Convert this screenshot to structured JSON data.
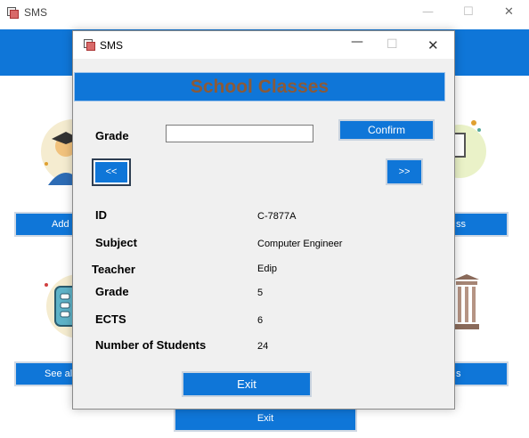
{
  "background_window": {
    "title": "SMS",
    "controls": {
      "minimize": "—",
      "maximize": "☐",
      "close": "✕"
    },
    "buttons": {
      "add_left": "Add S",
      "manage_right": "ss",
      "see_all_left": "See all",
      "see_all_right": "s",
      "exit": "Exit"
    }
  },
  "dialog": {
    "title": "SMS",
    "controls": {
      "minimize": "—",
      "maximize": "☐",
      "close": "✕"
    },
    "header": "School Classes",
    "grade_label": "Grade",
    "grade_input": {
      "value": "",
      "placeholder": ""
    },
    "confirm_label": "Confirm",
    "prev_label": "<<",
    "next_label": ">>",
    "fields": {
      "id": {
        "label": "ID",
        "value": "C-7877A"
      },
      "subject": {
        "label": "Subject",
        "value": "Computer Engineer"
      },
      "teacher": {
        "label": "Teacher",
        "value": "Edip"
      },
      "grade": {
        "label": "Grade",
        "value": "5"
      },
      "ects": {
        "label": "ECTS",
        "value": "6"
      },
      "students": {
        "label": "Number of Students",
        "value": "24"
      }
    },
    "exit_label": "Exit"
  },
  "colors": {
    "accent": "#0f76d8",
    "header_text": "#8a5a39",
    "dialog_bg": "#f0f0f0"
  }
}
